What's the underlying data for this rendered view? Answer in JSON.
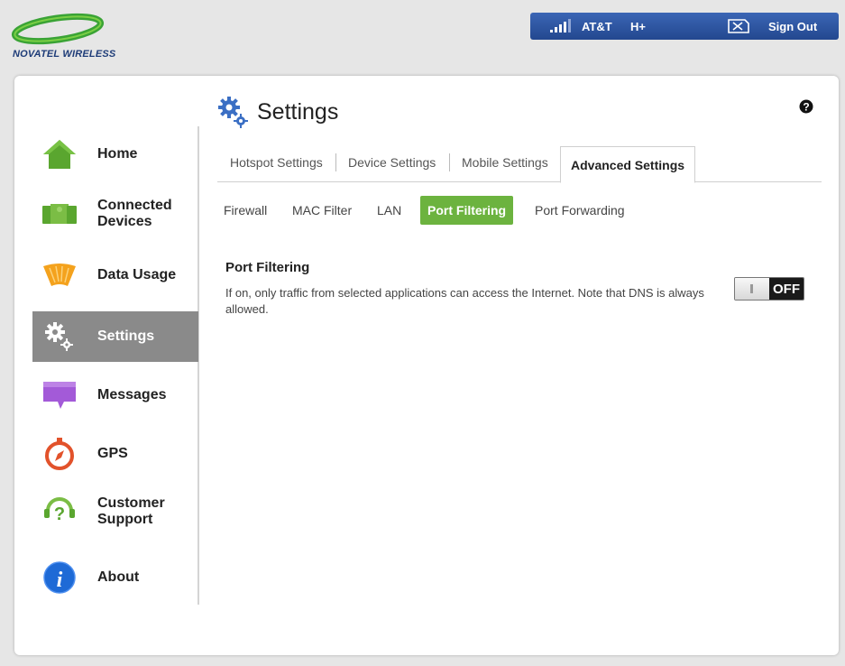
{
  "brand": {
    "name": "NOVATEL WIRELESS"
  },
  "status": {
    "carrier": "AT&T",
    "network": "H+",
    "sign_out_label": "Sign Out",
    "accent": "#2b4f9a"
  },
  "page": {
    "title": "Settings"
  },
  "sidebar": {
    "items": [
      {
        "label": "Home",
        "icon": "home-icon"
      },
      {
        "label": "Connected Devices",
        "icon": "devices-icon"
      },
      {
        "label": "Data Usage",
        "icon": "data-usage-icon"
      },
      {
        "label": "Settings",
        "icon": "gear-icon",
        "active": true
      },
      {
        "label": "Messages",
        "icon": "message-icon"
      },
      {
        "label": "GPS",
        "icon": "compass-icon"
      },
      {
        "label": "Customer Support",
        "icon": "support-icon"
      },
      {
        "label": "About",
        "icon": "info-icon"
      }
    ]
  },
  "tabs": [
    {
      "label": "Hotspot Settings"
    },
    {
      "label": "Device Settings"
    },
    {
      "label": "Mobile Settings"
    },
    {
      "label": "Advanced Settings",
      "active": true
    }
  ],
  "subtabs": [
    {
      "label": "Firewall"
    },
    {
      "label": "MAC Filter"
    },
    {
      "label": "LAN"
    },
    {
      "label": "Port Filtering",
      "active": true
    },
    {
      "label": "Port Forwarding"
    }
  ],
  "content": {
    "title": "Port Filtering",
    "description": "If on, only traffic from selected applications can access the Internet. Note that DNS is always allowed.",
    "toggle_state": "OFF"
  },
  "colors": {
    "active_subtab": "#6cb33f",
    "active_nav": "#8a8a8a"
  }
}
